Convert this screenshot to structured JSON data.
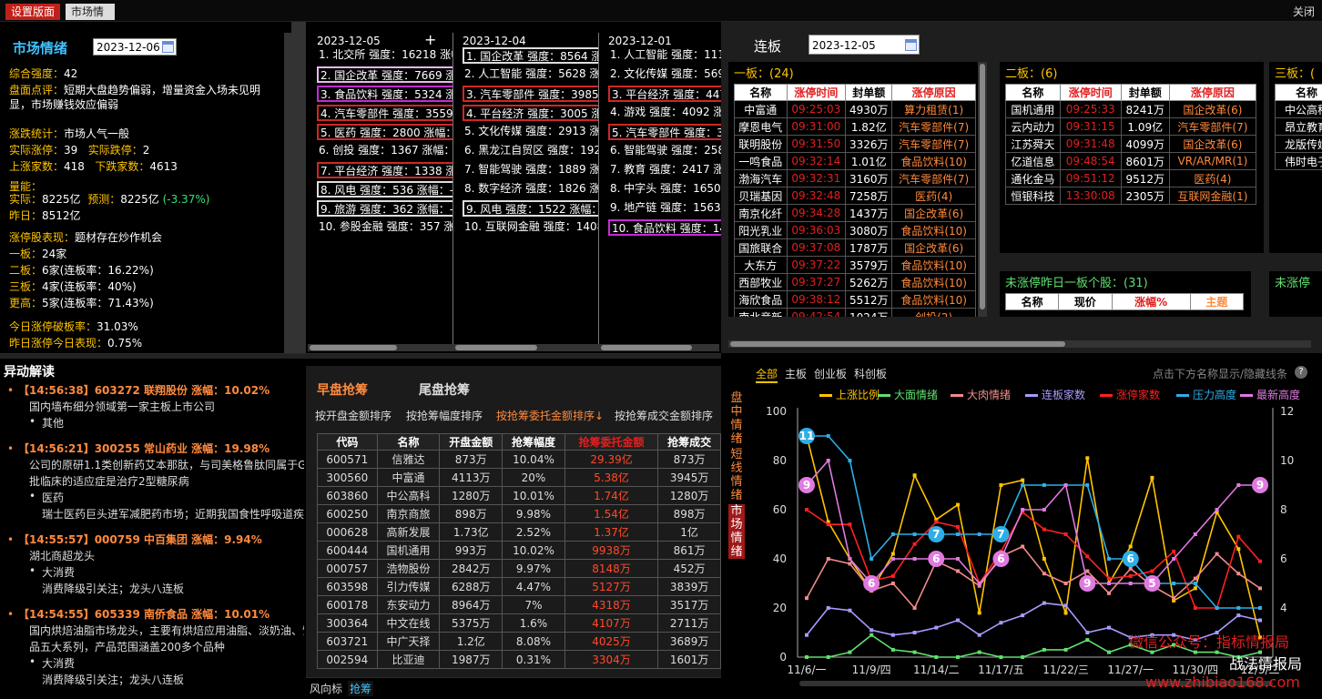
{
  "topbar": {
    "tab_layout": "设置版面",
    "tab_sentiment": "市场情绪",
    "close": "关闭"
  },
  "sentiment": {
    "title": "市场情绪",
    "date": "2023-12-06",
    "composite_label": "综合强度：",
    "composite": "42",
    "comment_label": "盘面点评：",
    "comment_1": "短期大盘趋势偏弱，增量资金入场未见明",
    "comment_2": "显，市场赚钱效应偏弱",
    "stats_label": "涨跌统计：",
    "stats_value": "市场人气一般",
    "actual_up_label": "实际涨停：",
    "actual_up": "39",
    "actual_down_label": "实际跌停：",
    "actual_down": "2",
    "rise_label": "上涨家数：",
    "rise": "418",
    "fall_label": "下跌家数：",
    "fall": "4613",
    "volume_label": "量能：",
    "vol_actual_label": "实际：",
    "vol_actual": "8225亿",
    "vol_pred_label": "预测：",
    "vol_pred": "8225亿",
    "vol_change": "(-3.37%)",
    "vol_yday_label": "昨日：",
    "vol_yday": "8512亿",
    "limit_perf_label": "涨停股表现：",
    "limit_perf": "题材存在炒作机会",
    "b1_label": "一板：",
    "b1": "24家",
    "b2_label": "二板：",
    "b2": "6家(连板率：16.22%)",
    "b3_label": "三板：",
    "b3": "4家(连板率：40%)",
    "b4_label": "更高：",
    "b4": "5家(连板率：71.43%)",
    "break_label": "今日涨停破板率：",
    "break_rate": "31.03%",
    "yday_perf_label": "昨日涨停今日表现：",
    "yday_perf": "0.75%"
  },
  "strength": [
    {
      "date": "2023-12-05",
      "plus": "+",
      "rows": [
        "1. 北交所 强度：16218 涨幅：",
        "2. 国企改革 强度：7669 涨幅",
        "3. 食品饮料 强度：5324 涨幅",
        "4. 汽车零部件 强度：3559 涨",
        "5. 医药 强度：2800 涨幅：",
        "6. 创投 强度：1367 涨幅：",
        "7. 平台经济 强度：1338 涨幅",
        "8. 风电 强度：536 涨幅：-",
        "9. 旅游 强度：362 涨幅：-",
        "10. 参股金融 强度：357 涨幅"
      ]
    },
    {
      "date": "2023-12-04",
      "rows": [
        "1. 国企改革 强度：8564 涨幅",
        "2. 人工智能 强度：5628 涨幅",
        "3. 汽车零部件 强度：3985 涨",
        "4. 平台经济 强度：3005 涨幅",
        "5. 文化传媒 强度：2913 涨幅",
        "6. 黑龙江自贸区 强度：1925",
        "7. 智能驾驶 强度：1889 涨幅",
        "8. 数字经济 强度：1826 涨幅",
        "9. 风电 强度：1522 涨幅：",
        "10. 互联网金融 强度：1408"
      ]
    },
    {
      "date": "2023-12-01",
      "rows": [
        "1. 人工智能 强度：1117",
        "2. 文化传媒 强度：5699",
        "3. 平台经济 强度：447",
        "4. 游戏 强度：4092 涨幅",
        "5. 汽车零部件 强度：34",
        "6. 智能驾驶 强度：2587",
        "7. 教育 强度：2417 涨幅",
        "8. 中字头 强度：1650 涨",
        "9. 地产链 强度：1563 涨",
        "10. 食品饮料 强度：14"
      ]
    }
  ],
  "lianban": {
    "title": "连板",
    "date": "2023-12-05",
    "one_board_title": "一板：(24)",
    "headers": [
      "名称",
      "涨停时间",
      "封单额",
      "涨停原因"
    ],
    "one_board": [
      [
        "中富通",
        "09:25:03",
        "4930万",
        "算力租赁(1)"
      ],
      [
        "摩恩电气",
        "09:31:00",
        "1.82亿",
        "汽车零部件(7)"
      ],
      [
        "联明股份",
        "09:31:50",
        "3326万",
        "汽车零部件(7)"
      ],
      [
        "一鸣食品",
        "09:32:14",
        "1.01亿",
        "食品饮料(10)"
      ],
      [
        "渤海汽车",
        "09:32:31",
        "3160万",
        "汽车零部件(7)"
      ],
      [
        "贝瑞基因",
        "09:32:48",
        "7258万",
        "医药(4)"
      ],
      [
        "南京化纤",
        "09:34:28",
        "1437万",
        "国企改革(6)"
      ],
      [
        "阳光乳业",
        "09:36:03",
        "3080万",
        "食品饮料(10)"
      ],
      [
        "国旅联合",
        "09:37:08",
        "1787万",
        "国企改革(6)"
      ],
      [
        "大东方",
        "09:37:22",
        "3579万",
        "食品饮料(10)"
      ],
      [
        "西部牧业",
        "09:37:27",
        "5262万",
        "食品饮料(10)"
      ],
      [
        "海欣食品",
        "09:38:12",
        "5512万",
        "食品饮料(10)"
      ],
      [
        "南北竞新",
        "09:42:54",
        "1024万",
        "创投(2)"
      ]
    ],
    "two_board_title": "二板：(6)",
    "two_board": [
      [
        "国机通用",
        "09:25:33",
        "8241万",
        "国企改革(6)"
      ],
      [
        "云内动力",
        "09:31:15",
        "1.09亿",
        "汽车零部件(7)"
      ],
      [
        "江苏舜天",
        "09:31:48",
        "4099万",
        "国企改革(6)"
      ],
      [
        "亿道信息",
        "09:48:54",
        "8601万",
        "VR/AR/MR(1)"
      ],
      [
        "通化金马",
        "09:51:12",
        "9512万",
        "医药(4)"
      ],
      [
        "恒银科技",
        "13:30:08",
        "2305万",
        "互联网金融(1)"
      ]
    ],
    "three_board_title": "三板：(",
    "three_board_header": "名称",
    "three_board": [
      "中公高科",
      "昂立教育",
      "龙版传媒",
      "伟时电子"
    ],
    "no_limit_title": "未涨停昨日一板个股：(31)",
    "no_limit_headers": [
      "名称",
      "现价",
      "涨幅%",
      "主题"
    ],
    "no_limit_title_2": "未涨停"
  },
  "yidong": {
    "title": "异动解读",
    "items": [
      {
        "head": "【14:56:38】603272  联翔股份    涨幅：10.02%",
        "desc": "国内墙布细分领域第一家主板上市公司",
        "tag": "其他",
        "sub": ""
      },
      {
        "head": "【14:56:21】300255  常山药业    涨幅：19.98%",
        "desc": "公司的原研1.1类创新药艾本那肽，与司美格鲁肽同属于G",
        "desc2": "批临床的适应症是治疗2型糖尿病",
        "tag": "医药",
        "sub": "瑞士医药巨头进军减肥药市场；近期我国食性呼吸道疾"
      },
      {
        "head": "【14:55:57】000759  中百集团    涨幅：9.94%",
        "desc": "湖北商超龙头",
        "tag": "大消费",
        "sub": "消费降级引关注；龙头八连板"
      },
      {
        "head": "【14:54:55】605339  南侨食品    涨幅：10.01%",
        "desc": "国内烘焙油脂市场龙头，主要有烘焙应用油脂、淡奶油、馅",
        "desc2": "品五大系列，产品范围涵盖200多个品种",
        "tag": "大消费",
        "sub": "消费降级引关注；龙头八连板"
      }
    ]
  },
  "qiangchou": {
    "tab_early": "早盘抢筹",
    "tab_late": "尾盘抢筹",
    "sorts": [
      "按开盘金额排序",
      "按抢筹幅度排序",
      "按抢筹委托金额排序↓",
      "按抢筹成交金额排序"
    ],
    "headers": [
      "代码",
      "名称",
      "开盘金额",
      "抢筹幅度",
      "抢筹委托金额",
      "抢筹成交"
    ],
    "rows": [
      [
        "600571",
        "信雅达",
        "873万",
        "10.04%",
        "29.39亿",
        "873万"
      ],
      [
        "300560",
        "中富通",
        "4113万",
        "20%",
        "5.38亿",
        "3945万"
      ],
      [
        "603860",
        "中公高科",
        "1280万",
        "10.01%",
        "1.74亿",
        "1280万"
      ],
      [
        "600250",
        "南京商旅",
        "898万",
        "9.98%",
        "1.54亿",
        "898万"
      ],
      [
        "000628",
        "高新发展",
        "1.73亿",
        "2.52%",
        "1.37亿",
        "1亿"
      ],
      [
        "600444",
        "国机通用",
        "993万",
        "10.02%",
        "9938万",
        "861万"
      ],
      [
        "000757",
        "浩物股份",
        "2842万",
        "9.97%",
        "8148万",
        "452万"
      ],
      [
        "603598",
        "引力传媒",
        "6288万",
        "4.47%",
        "5127万",
        "3839万"
      ],
      [
        "600178",
        "东安动力",
        "8964万",
        "7%",
        "4318万",
        "3517万"
      ],
      [
        "300364",
        "中文在线",
        "5375万",
        "1.6%",
        "4107万",
        "2711万"
      ],
      [
        "603721",
        "中广天择",
        "1.2亿",
        "8.08%",
        "4025万",
        "3689万"
      ],
      [
        "002594",
        "比亚迪",
        "1987万",
        "0.31%",
        "3304万",
        "1601万"
      ]
    ],
    "bottom_tab_1": "风向标",
    "bottom_tab_2": "抢筹"
  },
  "chart_panel": {
    "tabs": [
      "全部",
      "主板",
      "创业板",
      "科创板"
    ],
    "hint": "点击下方名称显示/隐藏线条",
    "help": "?",
    "side_tabs": [
      "盘中情绪",
      "短线情绪",
      "市场情绪"
    ],
    "watermark_1": "微信公众号：指标情报局",
    "watermark_2": "战法情报局",
    "watermark_3": "www.zhibiao168.com"
  },
  "chart_data": {
    "type": "line",
    "x": [
      "11/6/一",
      "11/7",
      "11/8",
      "11/9/四",
      "11/10",
      "11/13",
      "11/14/二",
      "11/15",
      "11/16",
      "11/17/五",
      "11/20",
      "11/21",
      "11/22/三",
      "11/23",
      "11/24",
      "11/27/一",
      "11/28",
      "11/29",
      "11/30/四",
      "12/1",
      "12/4",
      "12/5"
    ],
    "xticks": [
      "11/6/一",
      "11/9/四",
      "11/14/二",
      "11/17/五",
      "11/22/三",
      "11/27/一",
      "11/30/四",
      "12/5/二"
    ],
    "ylim": [
      0,
      100
    ],
    "yticks": [
      0,
      20,
      40,
      60,
      80,
      100
    ],
    "y2lim": [
      2,
      12
    ],
    "y2ticks": [
      4,
      6,
      8,
      10,
      12
    ],
    "series": [
      {
        "name": "上涨比例",
        "color": "#ffc400",
        "axis": "left",
        "values": [
          90,
          55,
          40,
          27,
          42,
          74,
          56,
          62,
          18,
          70,
          72,
          40,
          18,
          81,
          30,
          45,
          73,
          23,
          28,
          59,
          44,
          8
        ]
      },
      {
        "name": "大面情绪",
        "color": "#5fe06e",
        "axis": "left",
        "values": [
          0,
          0,
          2,
          9,
          3,
          2,
          0,
          0,
          2,
          0,
          0,
          3,
          3,
          7,
          2,
          5,
          2,
          5,
          2,
          2,
          0,
          2
        ]
      },
      {
        "name": "大肉情绪",
        "color": "#f28b8b",
        "axis": "left",
        "values": [
          24,
          40,
          38,
          27,
          30,
          20,
          39,
          35,
          29,
          41,
          45,
          34,
          30,
          35,
          26,
          36,
          29,
          24,
          32,
          42,
          34,
          28
        ]
      },
      {
        "name": "连板家数",
        "color": "#a79bff",
        "axis": "left",
        "values": [
          9,
          20,
          19,
          11,
          9,
          10,
          12,
          15,
          9,
          14,
          17,
          22,
          21,
          10,
          12,
          8,
          9,
          9,
          7,
          10,
          17,
          15
        ]
      },
      {
        "name": "涨停家数",
        "color": "#ff2020",
        "axis": "left",
        "values": [
          60,
          54,
          54,
          31,
          33,
          46,
          55,
          53,
          30,
          43,
          59,
          52,
          50,
          41,
          32,
          33,
          35,
          43,
          20,
          20,
          49,
          39
        ]
      },
      {
        "name": "压力高度",
        "color": "#2eaee8",
        "axis": "right",
        "values": [
          11,
          11,
          10,
          6,
          7,
          7,
          7,
          7,
          7,
          7,
          9,
          9,
          9,
          9,
          6,
          6,
          5,
          5,
          5,
          4,
          4,
          4
        ]
      },
      {
        "name": "最新高度",
        "color": "#e07ae0",
        "axis": "right",
        "values": [
          9,
          10,
          6,
          5,
          6,
          6,
          6,
          6,
          5,
          6,
          8,
          8,
          9,
          5,
          5,
          5,
          5,
          6,
          7,
          8,
          9,
          9
        ]
      }
    ],
    "markers": [
      {
        "series": "压力高度",
        "points": [
          [
            0,
            "11"
          ],
          [
            6,
            "7"
          ],
          [
            9,
            "7"
          ],
          [
            15,
            "6"
          ]
        ]
      },
      {
        "series": "最新高度",
        "points": [
          [
            0,
            "9"
          ],
          [
            3,
            "6"
          ],
          [
            6,
            "6"
          ],
          [
            9,
            "6"
          ],
          [
            13,
            "9"
          ],
          [
            16,
            "5"
          ],
          [
            21,
            "9"
          ]
        ]
      }
    ]
  }
}
